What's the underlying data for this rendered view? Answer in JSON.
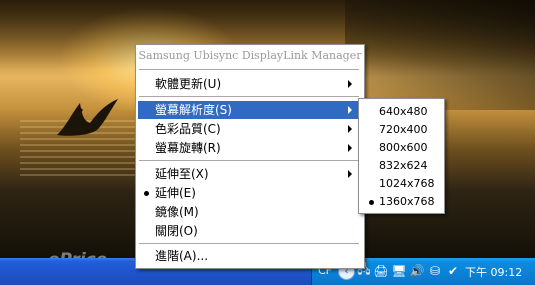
{
  "watermark": "ePrice",
  "menu": {
    "title": "Samsung Ubisync DisplayLink Manager",
    "items": [
      {
        "label": "軟體更新(U)",
        "submenu": true
      },
      {
        "label": "螢幕解析度(S)",
        "submenu": true,
        "highlighted": true
      },
      {
        "label": "色彩品質(C)",
        "submenu": true
      },
      {
        "label": "螢幕旋轉(R)",
        "submenu": true
      },
      {
        "label": "延伸至(X)",
        "submenu": true
      },
      {
        "label": "延伸(E)",
        "selected": true
      },
      {
        "label": "鏡像(M)"
      },
      {
        "label": "關閉(O)"
      },
      {
        "label": "進階(A)..."
      }
    ]
  },
  "resolution_submenu": {
    "options": [
      "640x480",
      "720x400",
      "800x600",
      "832x624",
      "1024x768",
      "1360x768"
    ],
    "selected": "1360x768"
  },
  "taskbar": {
    "language": "CF",
    "clock": "下午 09:12",
    "tray_icons": [
      "network-icon",
      "printer-icon",
      "display-icon",
      "volume-icon",
      "safely-remove-icon"
    ]
  }
}
